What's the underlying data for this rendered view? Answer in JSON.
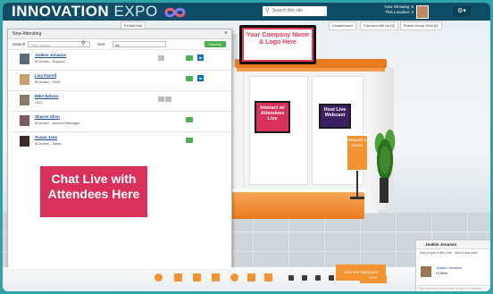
{
  "header": {
    "logo_main": "INNOVATION",
    "logo_sub": "EXPO",
    "search_placeholder": "Search this site",
    "status_line1": "Now Showing: 5",
    "status_line2": "This Location: 2",
    "settings_icon": "gear-icon",
    "menu_caret": "▾"
  },
  "toolbar": {
    "exhibit_hall": "Exhibit Hall",
    "leaderboard": "Leaderboard",
    "connect": "Connect with Us (0)",
    "public_group": "Public Group Chat (0)"
  },
  "attendee_panel": {
    "title": "Now Attending",
    "close": "×",
    "search_label": "Search",
    "filter_placeholder": "Filter results",
    "sort_label": "Sort",
    "sort_value": "All",
    "refresh": "Refresh",
    "rows": [
      {
        "name": "Joakim Jonason",
        "title": "6Connex - Support",
        "avatar_color": "#5b6b7a"
      },
      {
        "name": "Lisa Farrell",
        "title": "6Connex - CMO",
        "avatar_color": "#c9a06b"
      },
      {
        "name": "Mike Nelson",
        "title": "CEO",
        "avatar_color": "#8a7b6a"
      },
      {
        "name": "Sharon Shen",
        "title": "6Connex - Account Manager",
        "avatar_color": "#7a5a5a"
      },
      {
        "name": "Susan Jane",
        "title": "6Connex - Sales",
        "avatar_color": "#3b2b2b"
      }
    ]
  },
  "overlay_labels": {
    "chat_live": "Chat Live with Attendees Here",
    "company_logo": "Your Company Name & Logo Here",
    "interact": "Interact w/ Attendees Live",
    "host_webcast": "Host Live Webcast",
    "request_demo": "Request a Demo"
  },
  "dock": {
    "visit_sponsors": "Visit Our Sponsors",
    "people": "•••"
  },
  "chat_window": {
    "name": "Joakim Jonason",
    "action1": "Add people to this chat",
    "action2": "Start a new chat",
    "msg_name": "Joakim Jonason",
    "msg_text": "Hi Mike",
    "input_placeholder": "Type here and press enter to send a message"
  },
  "colors": {
    "brand_dark": "#0f4d66",
    "accent_orange": "#f39431",
    "accent_pink": "#d9315a",
    "online_green": "#4caf50",
    "linkedin_blue": "#1173b5"
  }
}
